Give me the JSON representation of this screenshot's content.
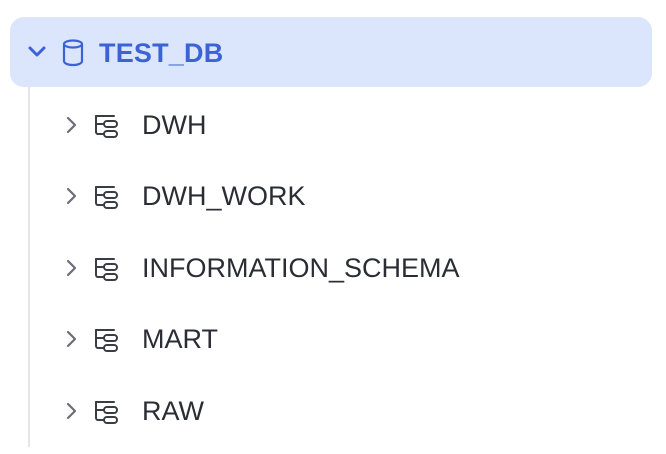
{
  "database": {
    "name": "TEST_DB",
    "expanded": true,
    "icon": "database-icon",
    "accent_color": "#3c63d6",
    "highlight_color": "#dbe6fd"
  },
  "schemas": [
    {
      "name": "DWH",
      "icon": "schema-icon",
      "expanded": false
    },
    {
      "name": "DWH_WORK",
      "icon": "schema-icon",
      "expanded": false
    },
    {
      "name": "INFORMATION_SCHEMA",
      "icon": "schema-icon",
      "expanded": false
    },
    {
      "name": "MART",
      "icon": "schema-icon",
      "expanded": false
    },
    {
      "name": "RAW",
      "icon": "schema-icon",
      "expanded": false
    }
  ]
}
